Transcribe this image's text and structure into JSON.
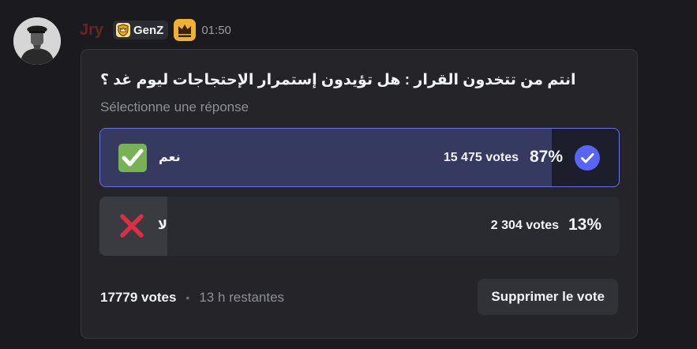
{
  "message": {
    "author": {
      "username": "Jry",
      "name_color": "#6b2424",
      "avatar_icon": "avatar-portrait"
    },
    "tag": {
      "icon": "shield-crown-icon",
      "label": "GenZ"
    },
    "badge_icon": "crown-icon",
    "timestamp": "01:50"
  },
  "poll": {
    "question": "انتم من تتخدون القرار : هل تؤيدون إستمرار الإحتجاجات ليوم غد ؟",
    "hint": "Sélectionne une réponse",
    "answers": [
      {
        "emoji": "check-mark-button-emoji",
        "label": "نعم",
        "votes_text": "15 475 votes",
        "percent_text": "87%",
        "percent": 87,
        "selected": true
      },
      {
        "emoji": "cross-mark-emoji",
        "label": "لا",
        "votes_text": "2 304 votes",
        "percent_text": "13%",
        "percent": 13,
        "selected": false
      }
    ],
    "footer": {
      "total_votes": "17779 votes",
      "separator": "•",
      "time_left": "13 h restantes"
    },
    "remove_vote_label": "Supprimer le vote"
  },
  "colors": {
    "accent": "#5865f2",
    "selected_border": "#6c73e8",
    "selected_fill": "#363960",
    "unselected_fill": "#3a3b41",
    "check_green": "#77b255",
    "cross_red": "#dd2e44",
    "crown_gold": "#f0b132"
  }
}
